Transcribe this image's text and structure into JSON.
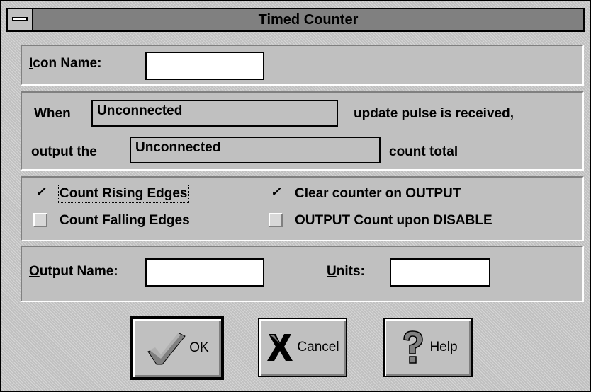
{
  "window": {
    "title": "Timed Counter"
  },
  "icon_name": {
    "label_mnemonic": "I",
    "label_rest": "con Name:",
    "value": ""
  },
  "update": {
    "when_label": "When",
    "input_value": "Unconnected",
    "suffix": "update pulse is received,",
    "output_label": "output the",
    "output_value": "Unconnected",
    "output_suffix": "count total"
  },
  "options": [
    {
      "label": "Count Rising Edges",
      "checked": true
    },
    {
      "label": "Count Falling Edges",
      "checked": false
    },
    {
      "label": "Clear counter on OUTPUT",
      "checked": true
    },
    {
      "label": "OUTPUT Count upon DISABLE",
      "checked": false
    }
  ],
  "output": {
    "name_mnemonic": "O",
    "name_rest": "utput Name:",
    "name_value": "",
    "units_mnemonic": "U",
    "units_rest": "nits:",
    "units_value": ""
  },
  "buttons": {
    "ok": "OK",
    "cancel": "Cancel",
    "help": "Help"
  },
  "check_glyph": "✓"
}
